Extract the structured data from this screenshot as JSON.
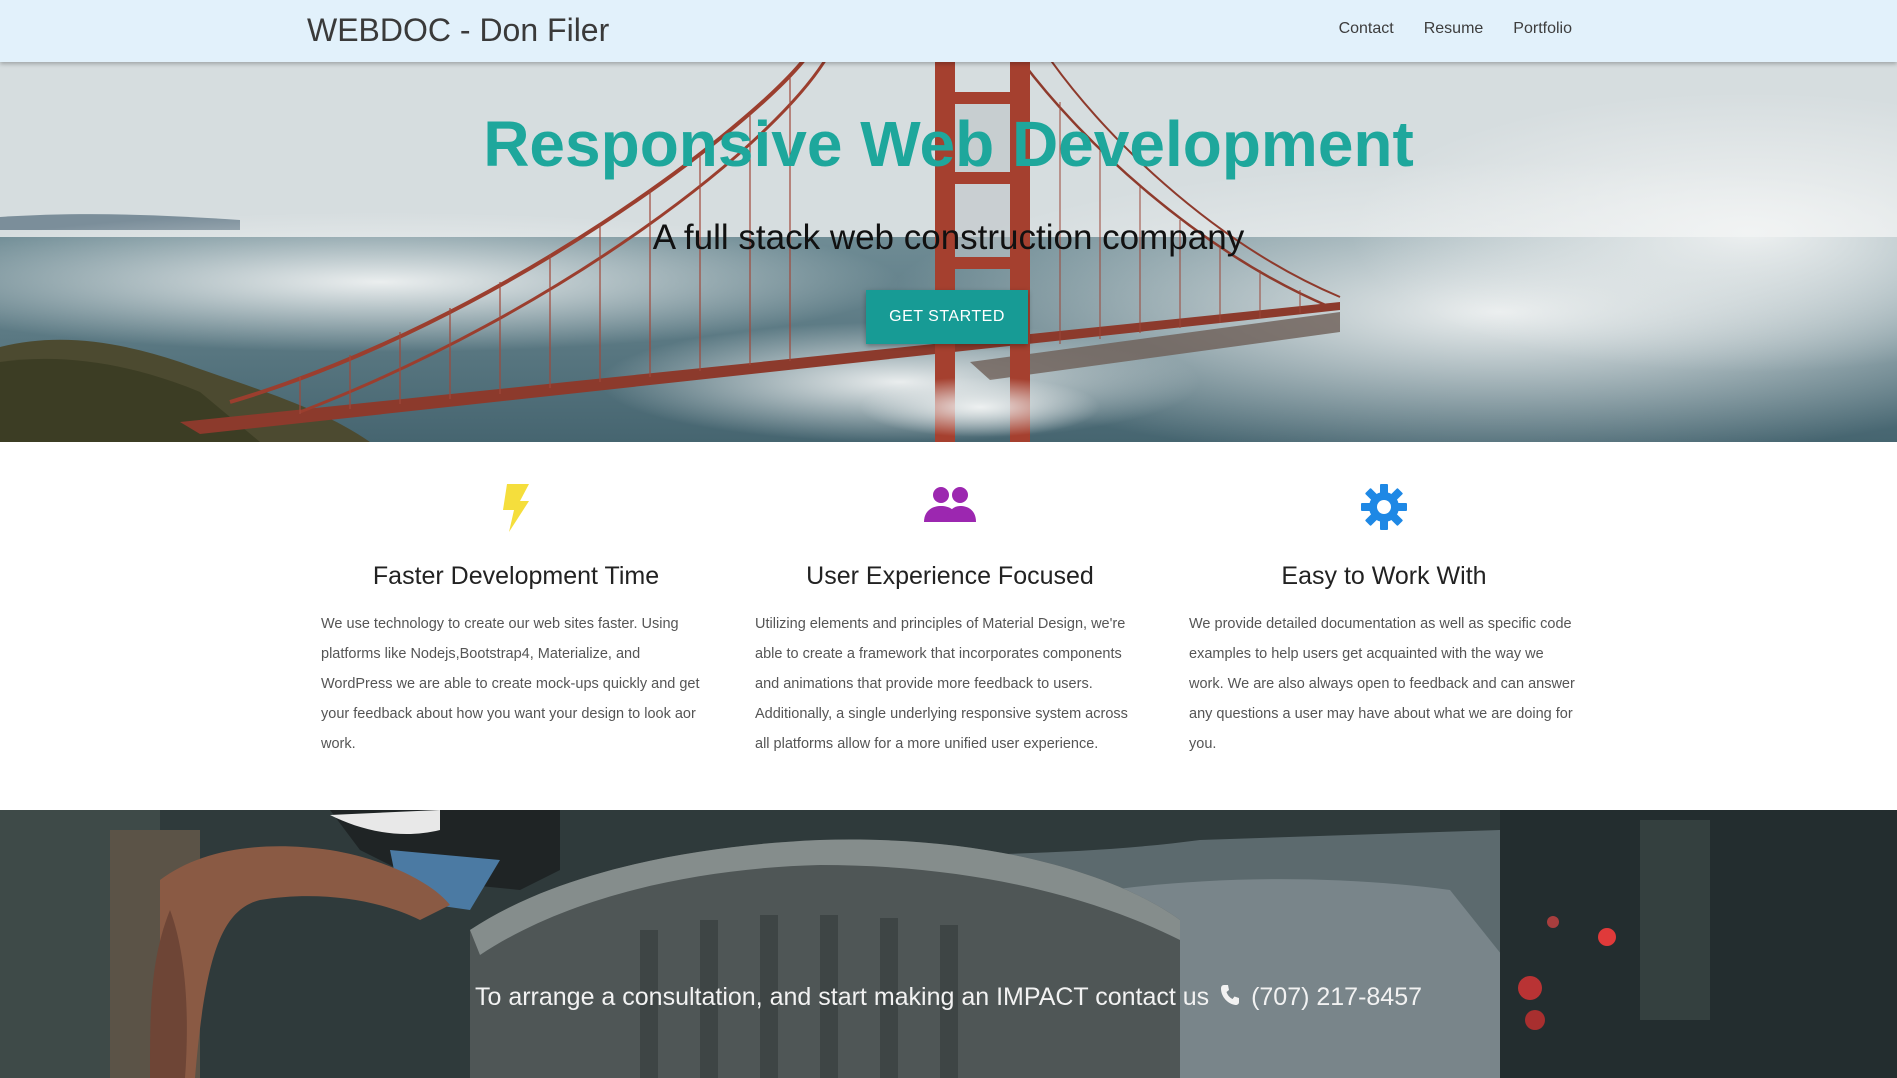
{
  "nav": {
    "brand": "WEBDOC - Don Filer",
    "links": [
      {
        "label": "Contact"
      },
      {
        "label": "Resume"
      },
      {
        "label": "Portfolio"
      }
    ]
  },
  "hero": {
    "title": "Responsive Web Development",
    "subtitle": "A full stack web construction company",
    "cta_label": "GET STARTED"
  },
  "features": [
    {
      "icon": "lightning-bolt-icon",
      "icon_color": "#f5de3c",
      "title": "Faster Development Time",
      "text": "We use technology to create our web sites faster. Using platforms like Nodejs,Bootstrap4, Materialize, and WordPress we are able to create mock-ups quickly and get your feedback about how you want your design to look aor work."
    },
    {
      "icon": "people-group-icon",
      "icon_color": "#9c27b0",
      "title": "User Experience Focused",
      "text": "Utilizing elements and principles of Material Design, we're able to create a framework that incorporates components and animations that provide more feedback to users. Additionally, a single underlying responsive system across all platforms allow for a more unified user experience."
    },
    {
      "icon": "gear-icon",
      "icon_color": "#1e88e5",
      "title": "Easy to Work With",
      "text": "We provide detailed documentation as well as specific code examples to help users get acquainted with the way we work. We are also always open to feedback and can answer any questions a user may have about what we are doing for you."
    }
  ],
  "contact": {
    "text": "To arrange a consultation, and start making an IMPACT contact us",
    "phone_icon": "phone-icon",
    "phone": "(707) 217-8457"
  },
  "colors": {
    "accent": "#1ea79c",
    "button": "#179b95",
    "navbar": "#e2f1fb"
  }
}
